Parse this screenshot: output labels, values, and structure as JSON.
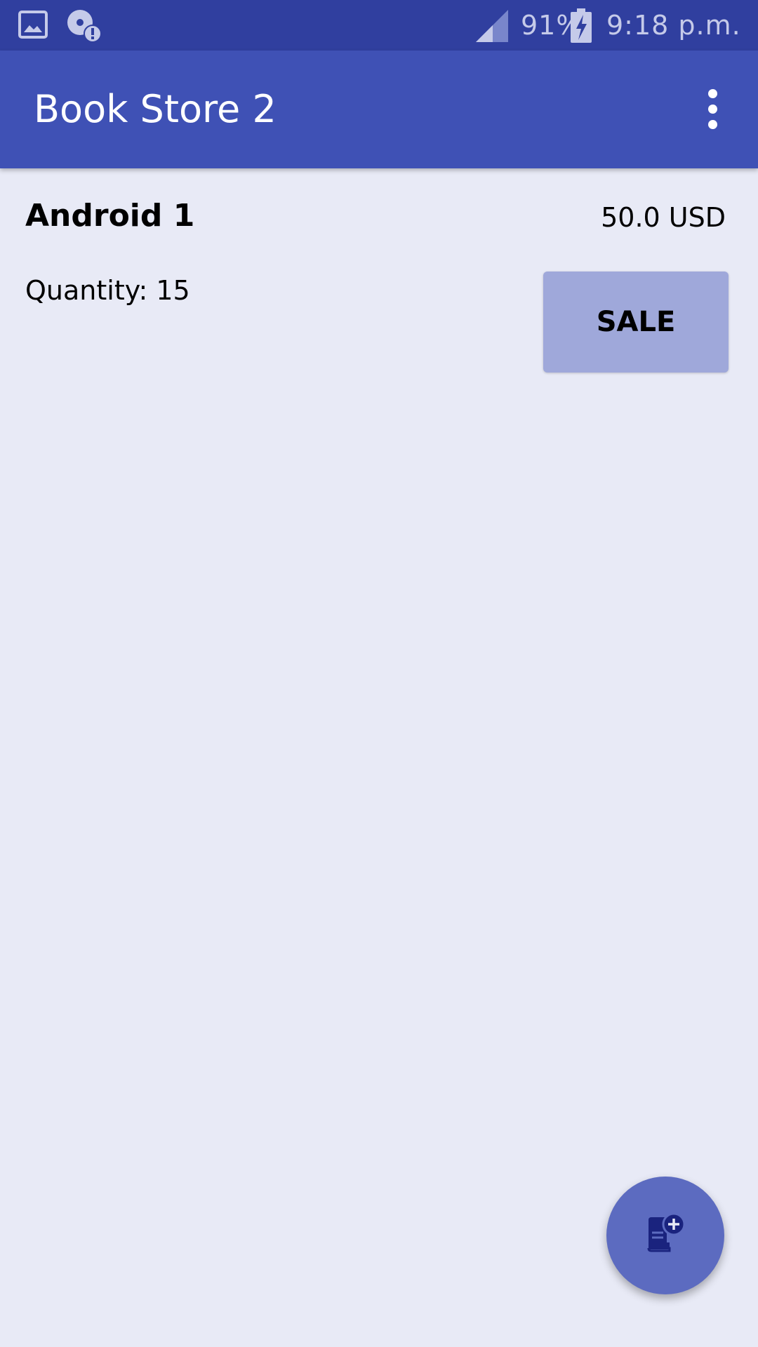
{
  "status_bar": {
    "battery_percent": "91%",
    "time": "9:18 p.m.",
    "icons": [
      "gallery-icon",
      "sync-error-icon",
      "signal-icon",
      "battery-charging-icon"
    ]
  },
  "app_bar": {
    "title": "Book Store 2",
    "overflow_icon": "more-vert-icon"
  },
  "products": [
    {
      "name": "Android 1",
      "price": "50.0 USD",
      "quantity": "Quantity: 15",
      "sale_label": "SALE"
    }
  ],
  "fab": {
    "icon": "add-book-icon"
  },
  "colors": {
    "status_bar": "#303f9f",
    "app_bar": "#3f51b5",
    "background": "#e8eaf6",
    "sale_button": "#9fa8da",
    "fab": "#5c6bc0"
  }
}
